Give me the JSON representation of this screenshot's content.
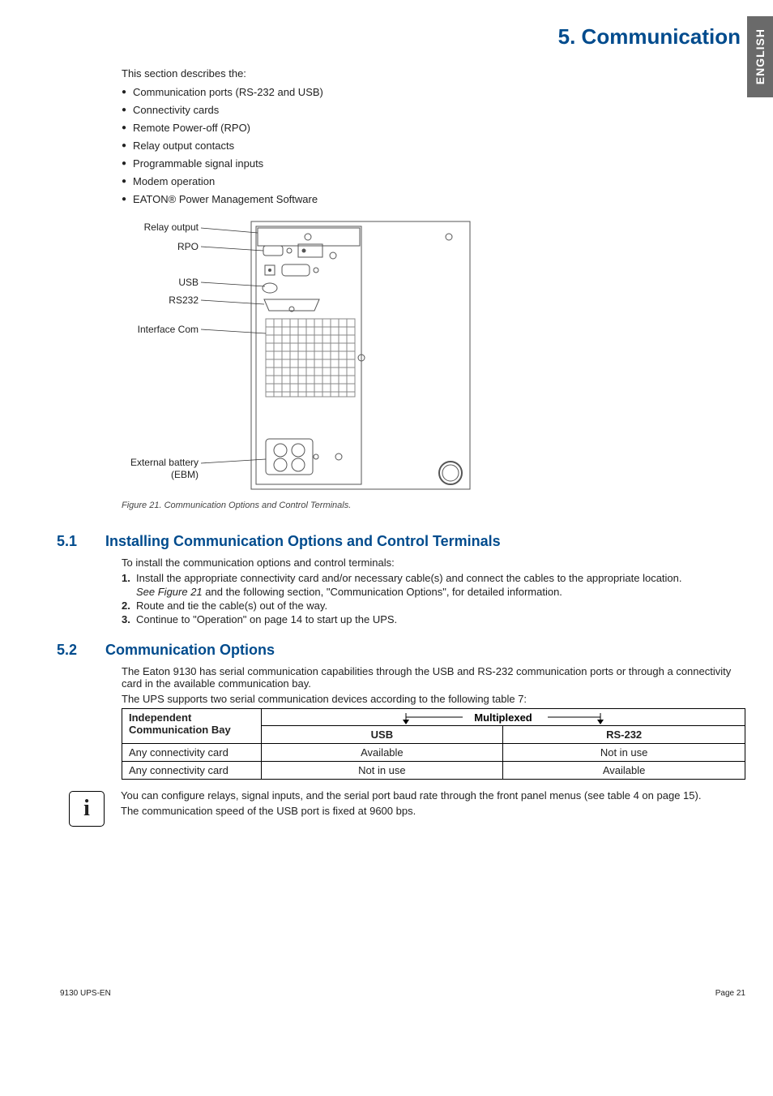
{
  "sideTab": "ENGLISH",
  "title": "5. Communication",
  "intro": "This section describes the:",
  "bullets": [
    "Communication ports (RS-232 and USB)",
    "Connectivity cards",
    "Remote Power-off (RPO)",
    "Relay output contacts",
    "Programmable signal inputs",
    "Modem operation",
    "EATON® Power Management Software"
  ],
  "figLabels": {
    "relay": "Relay output",
    "rpo": "RPO",
    "usb": "USB",
    "rs232": "RS232",
    "ifcom": "Interface Com",
    "ext": "External battery\n(EBM)"
  },
  "figCaption": "Figure 21. Communication Options and Control Terminals.",
  "s51": {
    "num": "5.1",
    "head": "Installing Communication Options and Control Terminals",
    "lead": "To install the communication options and control terminals:",
    "steps": [
      {
        "n": "1.",
        "t": "Install the appropriate connectivity card and/or necessary cable(s) and connect the cables to the appropriate location.",
        "sub": "See Figure 21",
        "subTail": " and the following section, \"Communication Options\", for detailed information."
      },
      {
        "n": "2.",
        "t": "Route and tie the cable(s) out of the way."
      },
      {
        "n": "3.",
        "t": "Continue to \"Operation\" on page 14 to start up the UPS."
      }
    ]
  },
  "s52": {
    "num": "5.2",
    "head": "Communication Options",
    "p1": "The Eaton 9130 has serial communication capabilities through the USB and RS-232 communication ports or through a connectivity card in the available communication bay.",
    "p2": "The UPS supports two serial communication devices according to the following table 7:",
    "table": {
      "h1": "Independent",
      "h2": "Communication Bay",
      "mux": "Multiplexed",
      "usb": "USB",
      "rs232": "RS-232",
      "rows": [
        {
          "c1": "Any connectivity card",
          "c2": "Available",
          "c3": "Not in use"
        },
        {
          "c1": "Any connectivity card",
          "c2": "Not in use",
          "c3": "Available"
        }
      ]
    }
  },
  "info": {
    "p1": "You can configure relays, signal inputs, and the serial port baud rate through the front panel menus (see table 4 on page 15).",
    "p2": "The communication speed of the USB port is fixed at 9600 bps."
  },
  "footer": {
    "left": "9130 UPS-EN",
    "right": "Page 21"
  }
}
